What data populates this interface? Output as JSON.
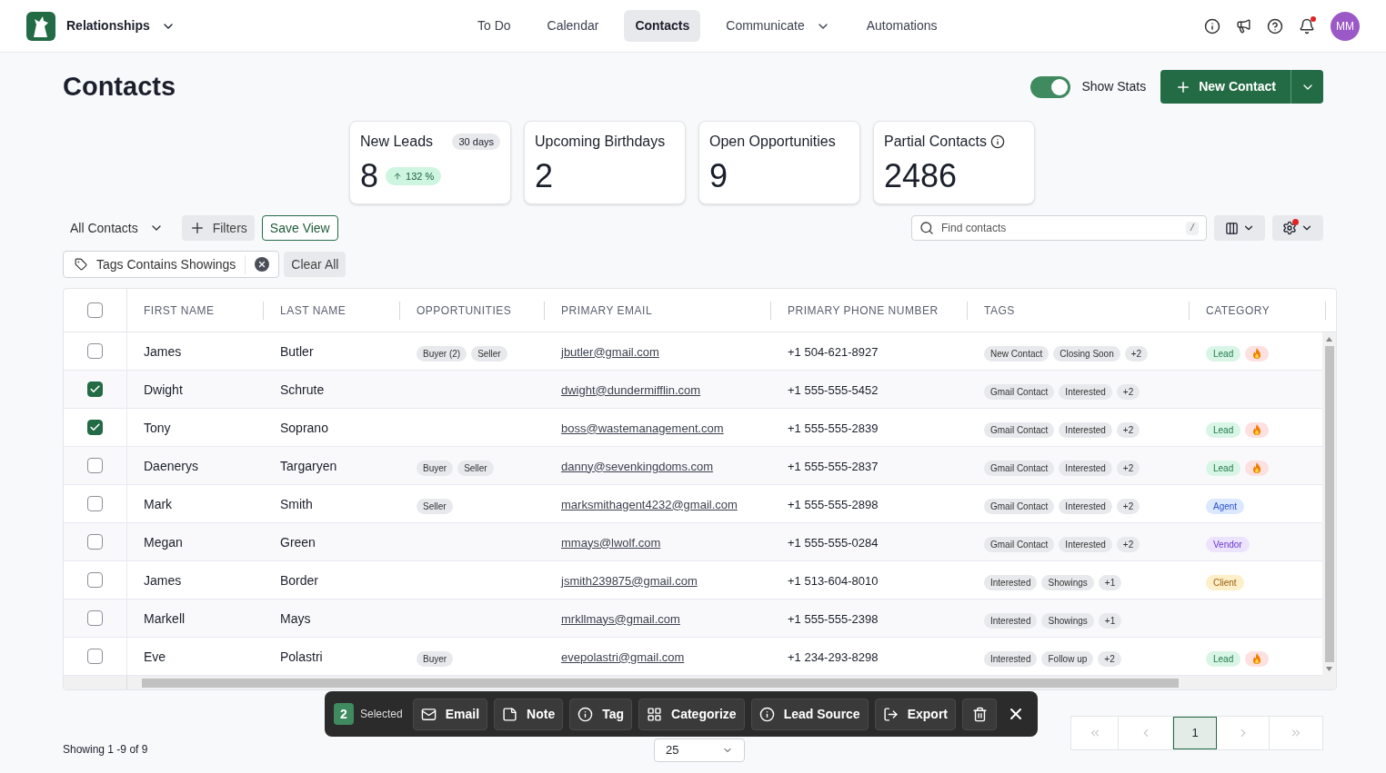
{
  "app": {
    "name": "Relationships"
  },
  "nav": [
    {
      "label": "To Do",
      "selected": false,
      "kind": "link"
    },
    {
      "label": "Calendar",
      "selected": false,
      "kind": "link"
    },
    {
      "label": "Contacts",
      "selected": true,
      "kind": "link"
    },
    {
      "label": "Communicate",
      "selected": false,
      "kind": "dropdown"
    },
    {
      "label": "Automations",
      "selected": false,
      "kind": "link"
    }
  ],
  "header_actions": {
    "notifications_unread": true,
    "avatar": "MM"
  },
  "page": {
    "title": "Contacts",
    "show_stats": {
      "label": "Show Stats",
      "on": true
    },
    "new_button": "New Contact"
  },
  "stats": [
    {
      "title": "New Leads",
      "value": "8",
      "badge": "30 days",
      "change": "132 %",
      "info": false
    },
    {
      "title": "Upcoming Birthdays",
      "value": "2",
      "info": false
    },
    {
      "title": "Open Opportunities",
      "value": "9",
      "info": false
    },
    {
      "title": "Partial Contacts",
      "value": "2486",
      "info": true
    }
  ],
  "toolbar": {
    "view": "All Contacts",
    "filters": "Filters",
    "save_view": "Save View",
    "search_placeholder": "Find contacts",
    "search_shortcut": "/",
    "settings_alert": true
  },
  "active_filters": [
    {
      "label": "Tags Contains Showings"
    }
  ],
  "clear_all": "Clear All",
  "table": {
    "columns": [
      "FIRST NAME",
      "LAST NAME",
      "OPPORTUNITIES",
      "PRIMARY EMAIL",
      "PRIMARY PHONE NUMBER",
      "TAGS",
      "CATEGORY"
    ],
    "all_checked": false,
    "rows": [
      {
        "checked": false,
        "first": "James",
        "last": "Butler",
        "opportunities": [
          "Buyer (2)",
          "Seller"
        ],
        "email": "jbutler@gmail.com",
        "phone": "+1 504-621-8927",
        "tags": [
          "New Contact",
          "Closing Soon",
          "+2"
        ],
        "category": {
          "label": "Lead",
          "kind": "lead",
          "hot": true
        }
      },
      {
        "checked": true,
        "first": "Dwight",
        "last": "Schrute",
        "opportunities": [],
        "email": "dwight@dundermifflin.com",
        "phone": "+1 555-555-5452",
        "tags": [
          "Gmail Contact",
          "Interested",
          "+2"
        ]
      },
      {
        "checked": true,
        "first": "Tony",
        "last": "Soprano",
        "opportunities": [],
        "email": "boss@wastemanagement.com",
        "phone": "+1 555-555-2839",
        "tags": [
          "Gmail Contact",
          "Interested",
          "+2"
        ],
        "category": {
          "label": "Lead",
          "kind": "lead",
          "hot": true
        }
      },
      {
        "checked": false,
        "first": "Daenerys",
        "last": "Targaryen",
        "opportunities": [
          "Buyer",
          "Seller"
        ],
        "email": "danny@sevenkingdoms.com",
        "phone": "+1 555-555-2837",
        "tags": [
          "Gmail Contact",
          "Interested",
          "+2"
        ],
        "category": {
          "label": "Lead",
          "kind": "lead",
          "hot": true
        }
      },
      {
        "checked": false,
        "first": "Mark",
        "last": "Smith",
        "opportunities": [
          "Seller"
        ],
        "email": "marksmithagent4232@gmail.com",
        "phone": "+1 555-555-2898",
        "tags": [
          "Gmail Contact",
          "Interested",
          "+2"
        ],
        "category": {
          "label": "Agent",
          "kind": "agent",
          "hot": false
        }
      },
      {
        "checked": false,
        "first": "Megan",
        "last": "Green",
        "opportunities": [],
        "email": "mmays@lwolf.com",
        "phone": "+1 555-555-0284",
        "tags": [
          "Gmail Contact",
          "Interested",
          "+2"
        ],
        "category": {
          "label": "Vendor",
          "kind": "vendor",
          "hot": false
        }
      },
      {
        "checked": false,
        "first": "James",
        "last": "Border",
        "opportunities": [],
        "email": "jsmith239875@gmail.com",
        "phone": "+1 513-604-8010",
        "tags": [
          "Interested",
          "Showings",
          "+1"
        ],
        "category": {
          "label": "Client",
          "kind": "client",
          "hot": false
        }
      },
      {
        "checked": false,
        "first": "Markell",
        "last": "Mays",
        "opportunities": [],
        "email": "mrkllmays@gmail.com",
        "phone": "+1 555-555-2398",
        "tags": [
          "Interested",
          "Showings",
          "+1"
        ]
      },
      {
        "checked": false,
        "first": "Eve",
        "last": "Polastri",
        "opportunities": [
          "Buyer"
        ],
        "email": "evepolastri@gmail.com",
        "phone": "+1 234-293-8298",
        "tags": [
          "Interested",
          "Follow up",
          "+2"
        ],
        "category": {
          "label": "Lead",
          "kind": "lead",
          "hot": true
        }
      }
    ]
  },
  "footer": {
    "showing": "Showing 1 -9 of 9",
    "page_size": "25",
    "pages": [
      {
        "label": "1",
        "selected": true
      }
    ]
  },
  "bulk_bar": {
    "count": "2",
    "selected_label": "Selected",
    "actions": [
      {
        "label": "Email",
        "kind": "email"
      },
      {
        "label": "Note",
        "kind": "note"
      },
      {
        "label": "Tag",
        "kind": "info"
      },
      {
        "label": "Categorize",
        "kind": "grid"
      },
      {
        "label": "Lead Source",
        "kind": "info"
      },
      {
        "label": "Export",
        "kind": "export"
      }
    ]
  }
}
